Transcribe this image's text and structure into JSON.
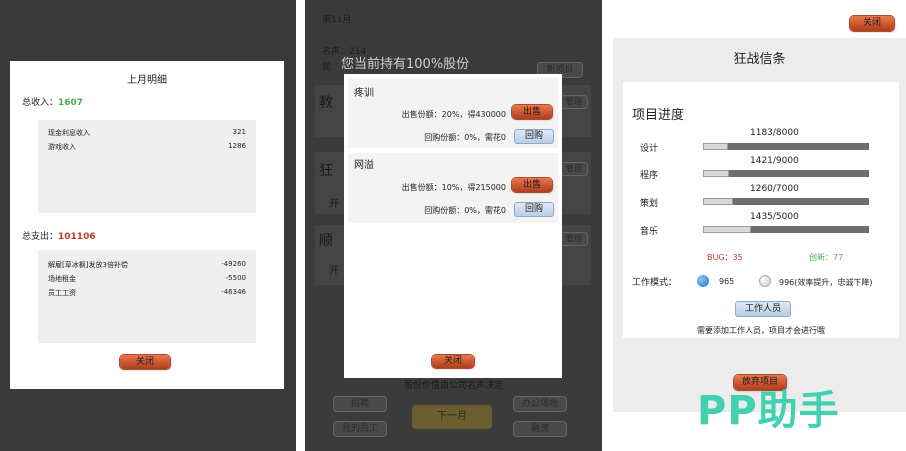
{
  "panel1": {
    "title": "上月明细",
    "income_label": "总收入：",
    "income_value": "1607",
    "income_rows": [
      {
        "label": "现金利息收入",
        "value": "321"
      },
      {
        "label": "游戏收入",
        "value": "1286"
      }
    ],
    "expense_label": "总支出：",
    "expense_value": "101106",
    "expense_rows": [
      {
        "label": "解雇[草冰枫]发放3倍补偿",
        "value": "-49260"
      },
      {
        "label": "场地租金",
        "value": "-5500"
      },
      {
        "label": "员工工资",
        "value": "-46346"
      }
    ],
    "close_label": "关闭",
    "colors": {
      "income": "#4caf50",
      "expense": "#c0392b"
    }
  },
  "panel2": {
    "month": "第11月",
    "fame": "名声：214",
    "bg_label_xian": "现",
    "bg_new_project": "新项目",
    "bg_side_chars": [
      "教",
      "狂",
      "顺"
    ],
    "bg_manage": [
      "管理",
      "管理",
      "管理"
    ],
    "bg_open": [
      "开",
      "开"
    ],
    "headline": "您当前持有100%股份",
    "companies": [
      {
        "name": "疼训",
        "sell_info": "出售份额：20%，得430000",
        "sell_label": "出售",
        "buy_info": "回购份额：0%，需花0",
        "buy_label": "回购"
      },
      {
        "name": "网溢",
        "sell_info": "出售份额：10%，得215000",
        "sell_label": "出售",
        "buy_info": "回购份额：0%，需花0",
        "buy_label": "回购"
      }
    ],
    "close_label": "关闭",
    "footer_note": "股份价值由公司名声决定",
    "bottom_buttons": {
      "recruit": "招聘",
      "office": "办公场地",
      "next_month": "下一月",
      "my_staff": "我的员工",
      "invest": "融资"
    }
  },
  "panel3": {
    "close_label": "关闭",
    "title": "狂战信条",
    "progress_title": "项目进度",
    "progress": [
      {
        "name": "设计",
        "text": "1183/8000",
        "current": 1183,
        "max": 8000
      },
      {
        "name": "程序",
        "text": "1421/9000",
        "current": 1421,
        "max": 9000
      },
      {
        "name": "策划",
        "text": "1260/7000",
        "current": 1260,
        "max": 7000
      },
      {
        "name": "音乐",
        "text": "1435/5000",
        "current": 1435,
        "max": 5000
      }
    ],
    "bug": "BUG：35",
    "innovation": "创新：77",
    "work_mode_label": "工作模式：",
    "mode_965": "965",
    "mode_996": "996(效率提升，忠诚下降)",
    "staff_button": "工作人员",
    "hint": "需要添加工作人员，项目才会进行哦",
    "abandon_button": "放弃项目",
    "watermark": "PP助手",
    "colors": {
      "bug": "#c0392b",
      "innovation": "#4caf50",
      "watermark": "#3fd1b0"
    }
  }
}
